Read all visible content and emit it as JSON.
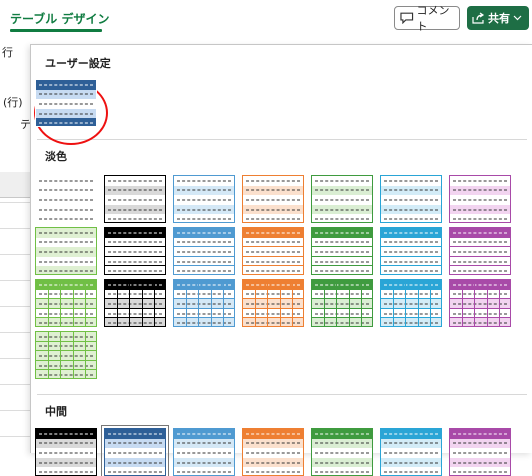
{
  "ribbon": {
    "tab_label": "テーブル デザイン",
    "comment_label": "コメント",
    "share_label": "共有",
    "bg_text_row": "行",
    "bg_text_row_paren": "(行)",
    "bg_text_te": "テ"
  },
  "gallery": {
    "sections": [
      {
        "id": "custom",
        "label": "ユーザー設定"
      },
      {
        "id": "light",
        "label": "淡色"
      },
      {
        "id": "medium",
        "label": "中間"
      }
    ],
    "colors": {
      "blue_dark": "#2e5f97",
      "blue_light": "#c7dbf2",
      "black": "#000000",
      "gray_light": "#d9d9d9",
      "lightblue": "#4f9ad1",
      "lightblue_light": "#d4e8f6",
      "orange": "#ee7f32",
      "orange_light": "#fbe0cd",
      "green": "#3f9b3f",
      "green_light": "#daeed3",
      "cyan": "#2aa5d6",
      "cyan_light": "#d3ecf7",
      "purple": "#a84aa8",
      "purple_light": "#f2d4f0",
      "lime": "#70bf45",
      "lime_light": "#dff0d2",
      "selection_circle": "#e11111"
    },
    "icons": {
      "comment": "speech-bubble-icon",
      "share": "share-icon",
      "dropdown": "chevron-down-icon"
    }
  }
}
